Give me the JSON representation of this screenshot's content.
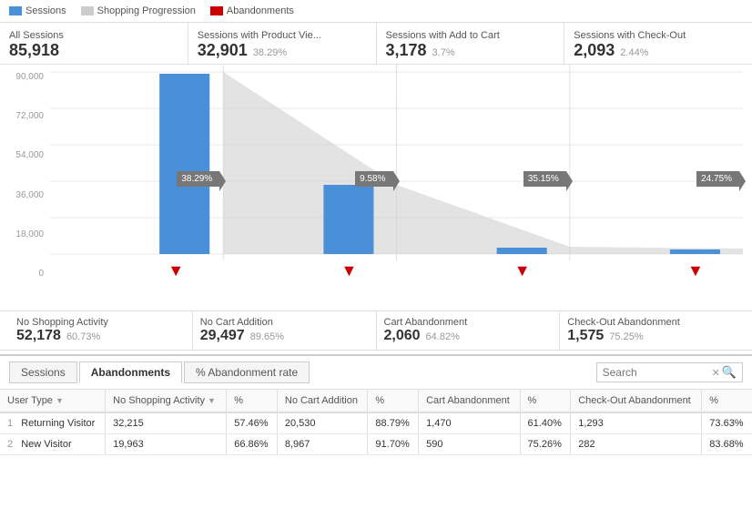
{
  "legend": {
    "items": [
      {
        "label": "Sessions",
        "color": "#4a90d9",
        "type": "solid"
      },
      {
        "label": "Shopping Progression",
        "color": "#cccccc",
        "type": "solid"
      },
      {
        "label": "Abandonments",
        "color": "#cc0000",
        "type": "solid"
      }
    ]
  },
  "metrics": [
    {
      "label": "All Sessions",
      "value": "85,918",
      "pct": ""
    },
    {
      "label": "Sessions with Product Vie...",
      "value": "32,901",
      "pct": "38.29%"
    },
    {
      "label": "Sessions with Add to Cart",
      "value": "3,178",
      "pct": "3.7%"
    },
    {
      "label": "Sessions with Check-Out",
      "value": "2,093",
      "pct": "2.44%"
    }
  ],
  "yAxis": [
    "90,000",
    "72,000",
    "54,000",
    "36,000",
    "18,000",
    "0"
  ],
  "funnelBadges": [
    "38.29%",
    "9.58%",
    "35.15%",
    "24.75%"
  ],
  "abandonments": [
    {
      "label": "No Shopping Activity",
      "value": "52,178",
      "pct": "60.73%"
    },
    {
      "label": "No Cart Addition",
      "value": "29,497",
      "pct": "89.65%"
    },
    {
      "label": "Cart Abandonment",
      "value": "2,060",
      "pct": "64.82%"
    },
    {
      "label": "Check-Out Abandonment",
      "value": "1,575",
      "pct": "75.25%"
    }
  ],
  "tabs": [
    "Sessions",
    "Abandonments",
    "% Abandonment rate"
  ],
  "activeTab": 1,
  "search": {
    "placeholder": "Search",
    "value": ""
  },
  "tableHeaders": [
    {
      "label": "User Type",
      "sortable": true
    },
    {
      "label": "No Shopping Activity",
      "sortable": true
    },
    {
      "label": "%",
      "sortable": false
    },
    {
      "label": "No Cart Addition",
      "sortable": false
    },
    {
      "label": "%",
      "sortable": false
    },
    {
      "label": "Cart Abandonment",
      "sortable": false
    },
    {
      "label": "%",
      "sortable": false
    },
    {
      "label": "Check-Out Abandonment",
      "sortable": false
    },
    {
      "label": "%",
      "sortable": false
    }
  ],
  "tableRows": [
    {
      "num": "1",
      "type": "Returning Visitor",
      "v1": "32,215",
      "p1": "57.46%",
      "v2": "20,530",
      "p2": "88.79%",
      "v3": "1,470",
      "p3": "61.40%",
      "v4": "1,293",
      "p4": "73.63%"
    },
    {
      "num": "2",
      "type": "New Visitor",
      "v1": "19,963",
      "p1": "66.86%",
      "v2": "8,967",
      "p2": "91.70%",
      "v3": "590",
      "p3": "75.26%",
      "v4": "282",
      "p4": "83.68%"
    }
  ]
}
